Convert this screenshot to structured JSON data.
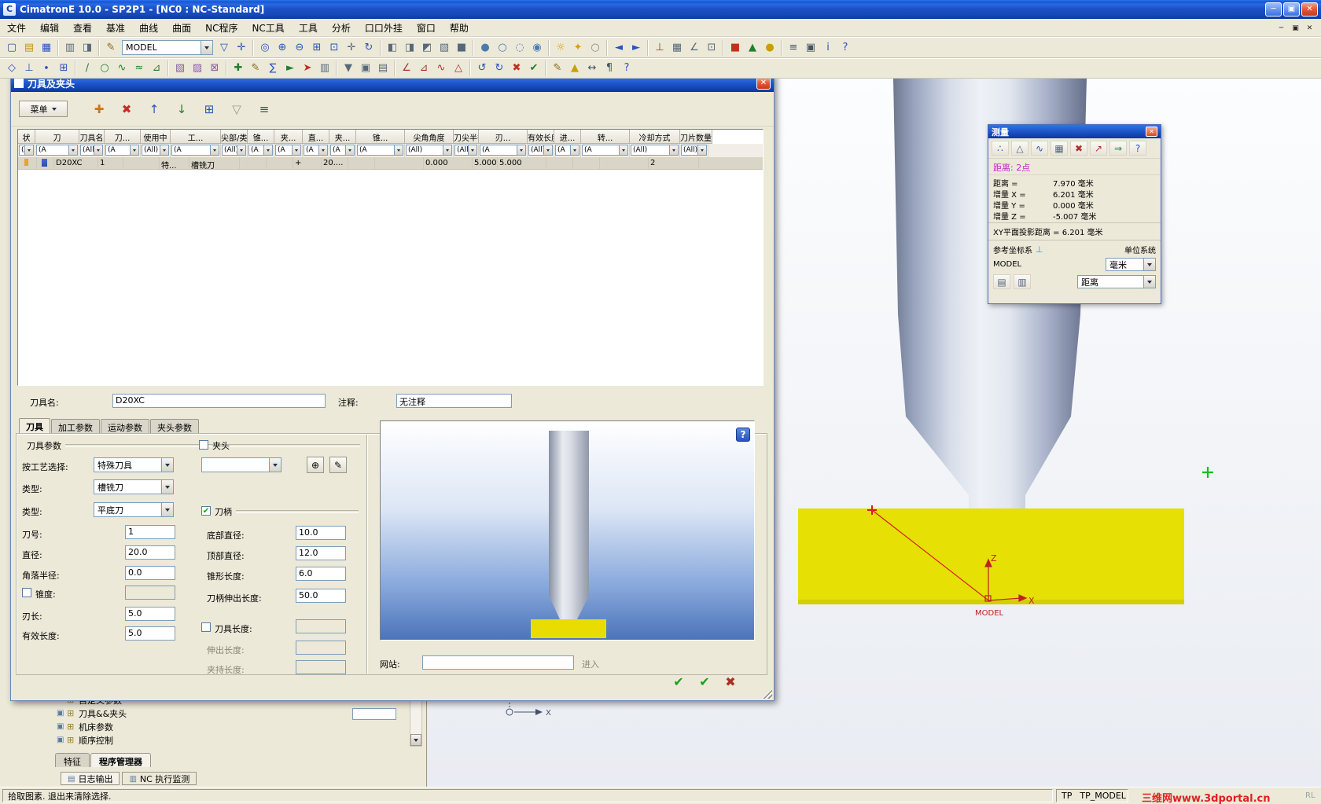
{
  "icons": {
    "app_badge": "C",
    "minimize": "─",
    "restore": "▣",
    "close": "✕",
    "check": "✔",
    "dialog_help": "?"
  },
  "title_bar": {
    "title": "CimatronE 10.0 - SP2P1 - [NC0 : NC-Standard]"
  },
  "menu_bar": {
    "items": [
      "文件",
      "编辑",
      "查看",
      "基准",
      "曲线",
      "曲面",
      "NC程序",
      "NC工具",
      "工具",
      "分析",
      "口口外挂",
      "窗口",
      "帮助"
    ]
  },
  "toolbar1": {
    "model_value": "MODEL",
    "g1": [
      {
        "n": "new-file-icon",
        "g": "▢",
        "c": "#34518E"
      },
      {
        "n": "open-file-icon",
        "g": "▤",
        "c": "#C79018"
      },
      {
        "n": "save-icon",
        "g": "▦",
        "c": "#2A52BE"
      }
    ],
    "g2": [
      {
        "n": "print-icon",
        "g": "▥",
        "c": "#5A6A7A"
      },
      {
        "n": "snapshot-icon",
        "g": "◨",
        "c": "#5A6A7A"
      }
    ],
    "g3": [
      {
        "n": "edit-model-icon",
        "g": "✎",
        "c": "#8A6A20"
      }
    ],
    "g4": [
      {
        "n": "selection-filter-icon",
        "g": "▽",
        "c": "#2A52BE"
      },
      {
        "n": "pick-icon",
        "g": "✛",
        "c": "#2A52BE"
      }
    ],
    "g5": [
      {
        "n": "redraw-icon",
        "g": "◎",
        "c": "#2A52BE"
      },
      {
        "n": "zoom-in-icon",
        "g": "⊕",
        "c": "#2A52BE"
      },
      {
        "n": "zoom-out-icon",
        "g": "⊖",
        "c": "#2A52BE"
      },
      {
        "n": "zoom-window-icon",
        "g": "⊞",
        "c": "#2A52BE"
      },
      {
        "n": "zoom-fit-icon",
        "g": "⊡",
        "c": "#2A52BE"
      },
      {
        "n": "pan-icon",
        "g": "✛",
        "c": "#56687A"
      },
      {
        "n": "rotate-view-icon",
        "g": "↻",
        "c": "#2A52BE"
      }
    ],
    "g6": [
      {
        "n": "view-iso-icon",
        "g": "◧",
        "c": "#56687A"
      },
      {
        "n": "view-front-icon",
        "g": "◨",
        "c": "#56687A"
      },
      {
        "n": "view-top-icon",
        "g": "◩",
        "c": "#56687A"
      },
      {
        "n": "view-right-icon",
        "g": "▧",
        "c": "#56687A"
      },
      {
        "n": "view-custom-icon",
        "g": "■",
        "c": "#56687A"
      }
    ],
    "g7": [
      {
        "n": "shaded-icon",
        "g": "●",
        "c": "#4A7AB0"
      },
      {
        "n": "wireframe-icon",
        "g": "○",
        "c": "#4A7AB0"
      },
      {
        "n": "hidden-line-icon",
        "g": "◌",
        "c": "#4A7AB0"
      },
      {
        "n": "translucent-icon",
        "g": "◉",
        "c": "#4A7AB0"
      }
    ],
    "g8": [
      {
        "n": "show-all-icon",
        "g": "☼",
        "c": "#D8A000"
      },
      {
        "n": "highlight-icon",
        "g": "✦",
        "c": "#D8A000"
      },
      {
        "n": "hide-icon",
        "g": "○",
        "c": "#888888"
      }
    ],
    "g9": [
      {
        "n": "previous-view-icon",
        "g": "◄",
        "c": "#2A52BE"
      },
      {
        "n": "next-view-icon",
        "g": "►",
        "c": "#2A52BE"
      }
    ],
    "g10": [
      {
        "n": "ucs-icon",
        "g": "⊥",
        "c": "#B03030"
      },
      {
        "n": "grid-icon",
        "g": "▦",
        "c": "#56687A"
      },
      {
        "n": "measure-tool-icon",
        "g": "∠",
        "c": "#56687A"
      },
      {
        "n": "snap-icon",
        "g": "⊡",
        "c": "#56687A"
      }
    ],
    "g11": [
      {
        "n": "record-icon",
        "g": "■",
        "c": "#C03020"
      },
      {
        "n": "play-icon",
        "g": "▲",
        "c": "#208030"
      },
      {
        "n": "lamp-icon",
        "g": "●",
        "c": "#C8A000"
      }
    ],
    "g12": [
      {
        "n": "layers-icon",
        "g": "≡",
        "c": "#445566"
      },
      {
        "n": "properties-icon",
        "g": "▣",
        "c": "#445566"
      },
      {
        "n": "info-icon",
        "g": "i",
        "c": "#2A52BE"
      },
      {
        "n": "help-icon",
        "g": "?",
        "c": "#2A52BE"
      }
    ]
  },
  "toolbar2": {
    "g1": [
      {
        "n": "datum-plane-icon",
        "g": "◇",
        "c": "#2A52BE"
      },
      {
        "n": "datum-axis-icon",
        "g": "⊥",
        "c": "#2A52BE"
      },
      {
        "n": "datum-point-icon",
        "g": "∙",
        "c": "#2A52BE"
      },
      {
        "n": "datum-csys-icon",
        "g": "⊞",
        "c": "#2A52BE"
      }
    ],
    "g2": [
      {
        "n": "line-icon",
        "g": "∕",
        "c": "#208030"
      },
      {
        "n": "circle-icon",
        "g": "○",
        "c": "#208030"
      },
      {
        "n": "spline-icon",
        "g": "∿",
        "c": "#208030"
      },
      {
        "n": "offset-icon",
        "g": "≈",
        "c": "#208030"
      },
      {
        "n": "project-curve-icon",
        "g": "⊿",
        "c": "#208030"
      }
    ],
    "g3": [
      {
        "n": "surface-patch-icon",
        "g": "▧",
        "c": "#8A5AB0"
      },
      {
        "n": "surface-blend-icon",
        "g": "▨",
        "c": "#8A5AB0"
      },
      {
        "n": "surface-trim-icon",
        "g": "⊠",
        "c": "#8A5AB0"
      }
    ],
    "g4": [
      {
        "n": "nc-create-icon",
        "g": "✚",
        "c": "#208030"
      },
      {
        "n": "nc-edit-icon",
        "g": "✎",
        "c": "#8A6A20"
      },
      {
        "n": "nc-calculate-icon",
        "g": "∑",
        "c": "#2A52BE"
      },
      {
        "n": "nc-simulate-icon",
        "g": "►",
        "c": "#208030"
      },
      {
        "n": "nc-postprocess-icon",
        "g": "➤",
        "c": "#C03020"
      },
      {
        "n": "nc-report-icon",
        "g": "▥",
        "c": "#56687A"
      }
    ],
    "g5": [
      {
        "n": "tool-manager-icon",
        "g": "▼",
        "c": "#56687A"
      },
      {
        "n": "holder-icon",
        "g": "▣",
        "c": "#56687A"
      },
      {
        "n": "tool-library-icon",
        "g": "▤",
        "c": "#56687A"
      }
    ],
    "g6": [
      {
        "n": "measure-distance-icon",
        "g": "∠",
        "c": "#B03030"
      },
      {
        "n": "measure-angle-icon",
        "g": "⊿",
        "c": "#B03030"
      },
      {
        "n": "curvature-icon",
        "g": "∿",
        "c": "#B03030"
      },
      {
        "n": "draft-analysis-icon",
        "g": "△",
        "c": "#B03030"
      }
    ],
    "g7": [
      {
        "n": "undo-icon",
        "g": "↺",
        "c": "#2A52BE"
      },
      {
        "n": "redo-icon",
        "g": "↻",
        "c": "#2A52BE"
      },
      {
        "n": "delete-icon",
        "g": "✖",
        "c": "#C03020"
      },
      {
        "n": "confirm-icon",
        "g": "✔",
        "c": "#208030"
      }
    ],
    "g8": [
      {
        "n": "annotate-icon",
        "g": "✎",
        "c": "#8A6A20"
      },
      {
        "n": "flag-icon",
        "g": "▲",
        "c": "#C8A000"
      },
      {
        "n": "dimension-icon",
        "g": "↔",
        "c": "#445566"
      },
      {
        "n": "note-icon",
        "g": "¶",
        "c": "#445566"
      },
      {
        "n": "context-help-icon",
        "g": "?",
        "c": "#2A52BE"
      }
    ]
  },
  "tool_dialog": {
    "title": "刀具及夹头",
    "menu_button": "菜单",
    "toolbar_icons": [
      {
        "n": "add-tool-icon",
        "g": "✚",
        "c": "#C87820"
      },
      {
        "n": "delete-tool-icon",
        "g": "✖",
        "c": "#C03028"
      },
      {
        "n": "import-tool-icon",
        "g": "↑",
        "c": "#2A52BE"
      },
      {
        "n": "export-tool-icon",
        "g": "↓",
        "c": "#208030"
      },
      {
        "n": "copy-tool-icon",
        "g": "⊞",
        "c": "#2A52BE"
      },
      {
        "n": "filter-tools-icon",
        "g": "▽",
        "c": "#9A968A"
      },
      {
        "n": "tool-table-icon",
        "g": "≡",
        "c": "#44506A"
      }
    ],
    "grid": {
      "headers": [
        "状",
        "刀",
        "刀具名",
        "刀...",
        "使用中",
        "工...",
        "尖部/类型",
        "锥...",
        "夹...",
        "直...",
        "夹...",
        "锥...",
        "尖角角度",
        "刀尖半径",
        "刃...",
        "有效长度",
        "进...",
        "转...",
        "冷却方式",
        "刀片数量"
      ],
      "filters": [
        "(A",
        "(A",
        "(All)",
        "(A",
        "(All)",
        "(A",
        "(All)",
        "(A",
        "(A",
        "(A",
        "(A",
        "(A",
        "(All)",
        "(All)",
        "(A",
        "(All)",
        "(A",
        "(A",
        "(All)",
        "(All)"
      ],
      "row": [
        "",
        "",
        "D20XC",
        "1",
        "",
        "特...",
        "槽铣刀",
        "",
        "",
        "+",
        "20....",
        "",
        "",
        "0.000",
        "5.000",
        "5.000",
        "",
        "",
        "",
        "2"
      ]
    },
    "name_label": "刀具名:",
    "name_value": "D20XC",
    "comment_label": "注释:",
    "comment_value": "无注释",
    "tabs": [
      "刀具",
      "加工参数",
      "运动参数",
      "夹头参数"
    ],
    "left_form": {
      "group": "刀具参数",
      "process_label": "按工艺选择:",
      "process_value": "特殊刀具",
      "type1_label": "类型:",
      "type1_value": "槽铣刀",
      "type2_label": "类型:",
      "type2_value": "平底刀",
      "number_label": "刀号:",
      "number_value": "1",
      "diameter_label": "直径:",
      "diameter_value": "20.0",
      "corner_label": "角落半径:",
      "corner_value": "0.0",
      "taper_label": "锥度:",
      "flute_label": "刃长:",
      "flute_value": "5.0",
      "eff_label": "有效长度:",
      "eff_value": "5.0"
    },
    "holder": {
      "label": "夹头"
    },
    "shank": {
      "label": "刀柄",
      "bottom_label": "底部直径:",
      "bottom_value": "10.0",
      "top_label": "顶部直径:",
      "top_value": "12.0",
      "taper_len_label": "锥形长度:",
      "taper_len_value": "6.0",
      "ext_label": "刀柄伸出长度:",
      "ext_value": "50.0",
      "tool_len_label": "刀具长度:",
      "out_len_label": "伸出长度:",
      "hold_len_label": "夹持长度:"
    },
    "website_label": "网站:",
    "enter_label": "进入",
    "actions": [
      {
        "n": "ok-button",
        "g": "✔",
        "c": "#18A018"
      },
      {
        "n": "apply-button",
        "g": "✔",
        "c": "#18A018"
      },
      {
        "n": "cancel-button",
        "g": "✖",
        "c": "#A83020"
      }
    ]
  },
  "measure_dialog": {
    "title": "测量",
    "toolbar": [
      {
        "n": "measure-distance-icon",
        "g": "∴",
        "c": "#2A52BE"
      },
      {
        "n": "measure-angle-icon",
        "g": "△",
        "c": "#56687A"
      },
      {
        "n": "measure-curve-icon",
        "g": "∿",
        "c": "#2A52BE"
      },
      {
        "n": "measure-table-icon",
        "g": "▦",
        "c": "#56687A"
      },
      {
        "n": "measure-delete-icon",
        "g": "✖",
        "c": "#B03030"
      },
      {
        "n": "measure-normal-icon",
        "g": "↗",
        "c": "#B03030"
      },
      {
        "n": "measure-export-icon",
        "g": "⇒",
        "c": "#208030"
      },
      {
        "n": "measure-help-icon",
        "g": "?",
        "c": "#2A52BE"
      }
    ],
    "mode": "距离: 2点",
    "rows": [
      {
        "label": "距离 =",
        "value": "7.970 毫米"
      },
      {
        "label": "增量 X =",
        "value": "6.201 毫米"
      },
      {
        "label": "增量 Y =",
        "value": "0.000 毫米"
      },
      {
        "label": "增量 Z =",
        "value": "-5.007 毫米"
      }
    ],
    "projection": "XY平面投影距离 = 6.201 毫米",
    "ref_label": "参考坐标系",
    "unit_label": "单位系统",
    "ref_value": "MODEL",
    "unit_value": "毫米",
    "bottom_icons": [
      {
        "n": "measure-save-icon",
        "g": "▤",
        "c": "#56687A"
      },
      {
        "n": "measure-print-icon",
        "g": "▥",
        "c": "#56687A"
      }
    ],
    "type_value": "距离"
  },
  "left_panel": {
    "tree": [
      {
        "i1": "",
        "i2": "⊞",
        "label": "自定义参数"
      },
      {
        "i1": "▣",
        "i2": "⊞",
        "label": "刀具&&夹头"
      },
      {
        "i1": "▣",
        "i2": "⊞",
        "label": "机床参数"
      },
      {
        "i1": "▣",
        "i2": "⊞",
        "label": "顺序控制"
      }
    ],
    "tabs": {
      "feature": "特征",
      "program": "程序管理器"
    },
    "output_tabs": {
      "log": "日志输出",
      "nc": "NC 执行监测"
    }
  },
  "viewport": {
    "z": "Z",
    "x": "X",
    "origin": "MODEL",
    "mini_axis": "X"
  },
  "status_bar": {
    "message": "拾取图素. 退出来清除选择.",
    "tp1": "TP",
    "tp2": "TP_MODEL",
    "watermark": "三维网www.3dportal.cn",
    "corner": "RL"
  }
}
